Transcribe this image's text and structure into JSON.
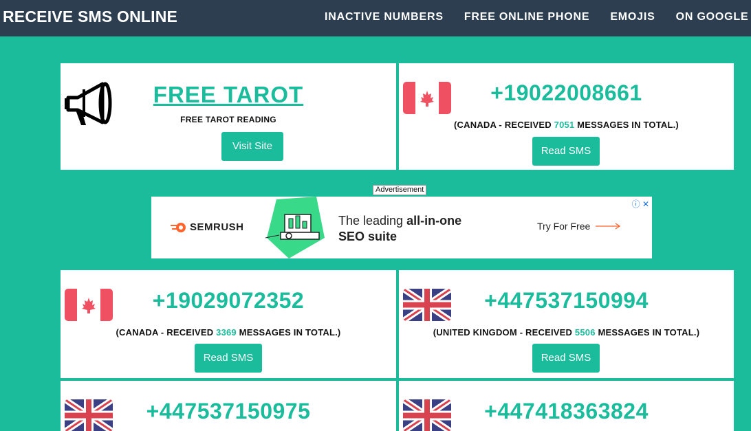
{
  "header": {
    "brand": "RECEIVE SMS ONLINE",
    "nav": [
      "INACTIVE NUMBERS",
      "FREE ONLINE PHONE",
      "EMOJIS",
      "ON GOOGLE"
    ]
  },
  "promo": {
    "icon": "megaphone-icon",
    "title": "FREE TAROT",
    "subtitle": "FREE TAROT READING",
    "button": "Visit Site"
  },
  "advert": {
    "label": "Advertisement",
    "brand": "SEMRUSH",
    "headline_pre": "The leading ",
    "headline_bold": "all-in-one",
    "headline_line2": "SEO suite",
    "cta": "Try For Free"
  },
  "numbers": [
    {
      "number": "+19022008661",
      "info_pre": "(CANADA - RECEIVED ",
      "count": "7051",
      "info_post": " MESSAGES IN TOTAL.)",
      "button": "Read SMS",
      "flag": "canada"
    },
    {
      "number": "+19029072352",
      "info_pre": "(CANADA - RECEIVED ",
      "count": "3369",
      "info_post": " MESSAGES IN TOTAL.)",
      "button": "Read SMS",
      "flag": "canada"
    },
    {
      "number": "+447537150994",
      "info_pre": "(UNITED KINGDOM - RECEIVED ",
      "count": "5506",
      "info_post": " MESSAGES IN TOTAL.)",
      "button": "Read SMS",
      "flag": "uk"
    },
    {
      "number": "+447537150975",
      "flag": "uk"
    },
    {
      "number": "+447418363824",
      "flag": "uk"
    }
  ],
  "colors": {
    "accent": "#1abc9c",
    "header_bg": "#2c3e50",
    "canada_red": "#ef5163",
    "uk_blue": "#3b3f83",
    "uk_red": "#d9434f"
  }
}
